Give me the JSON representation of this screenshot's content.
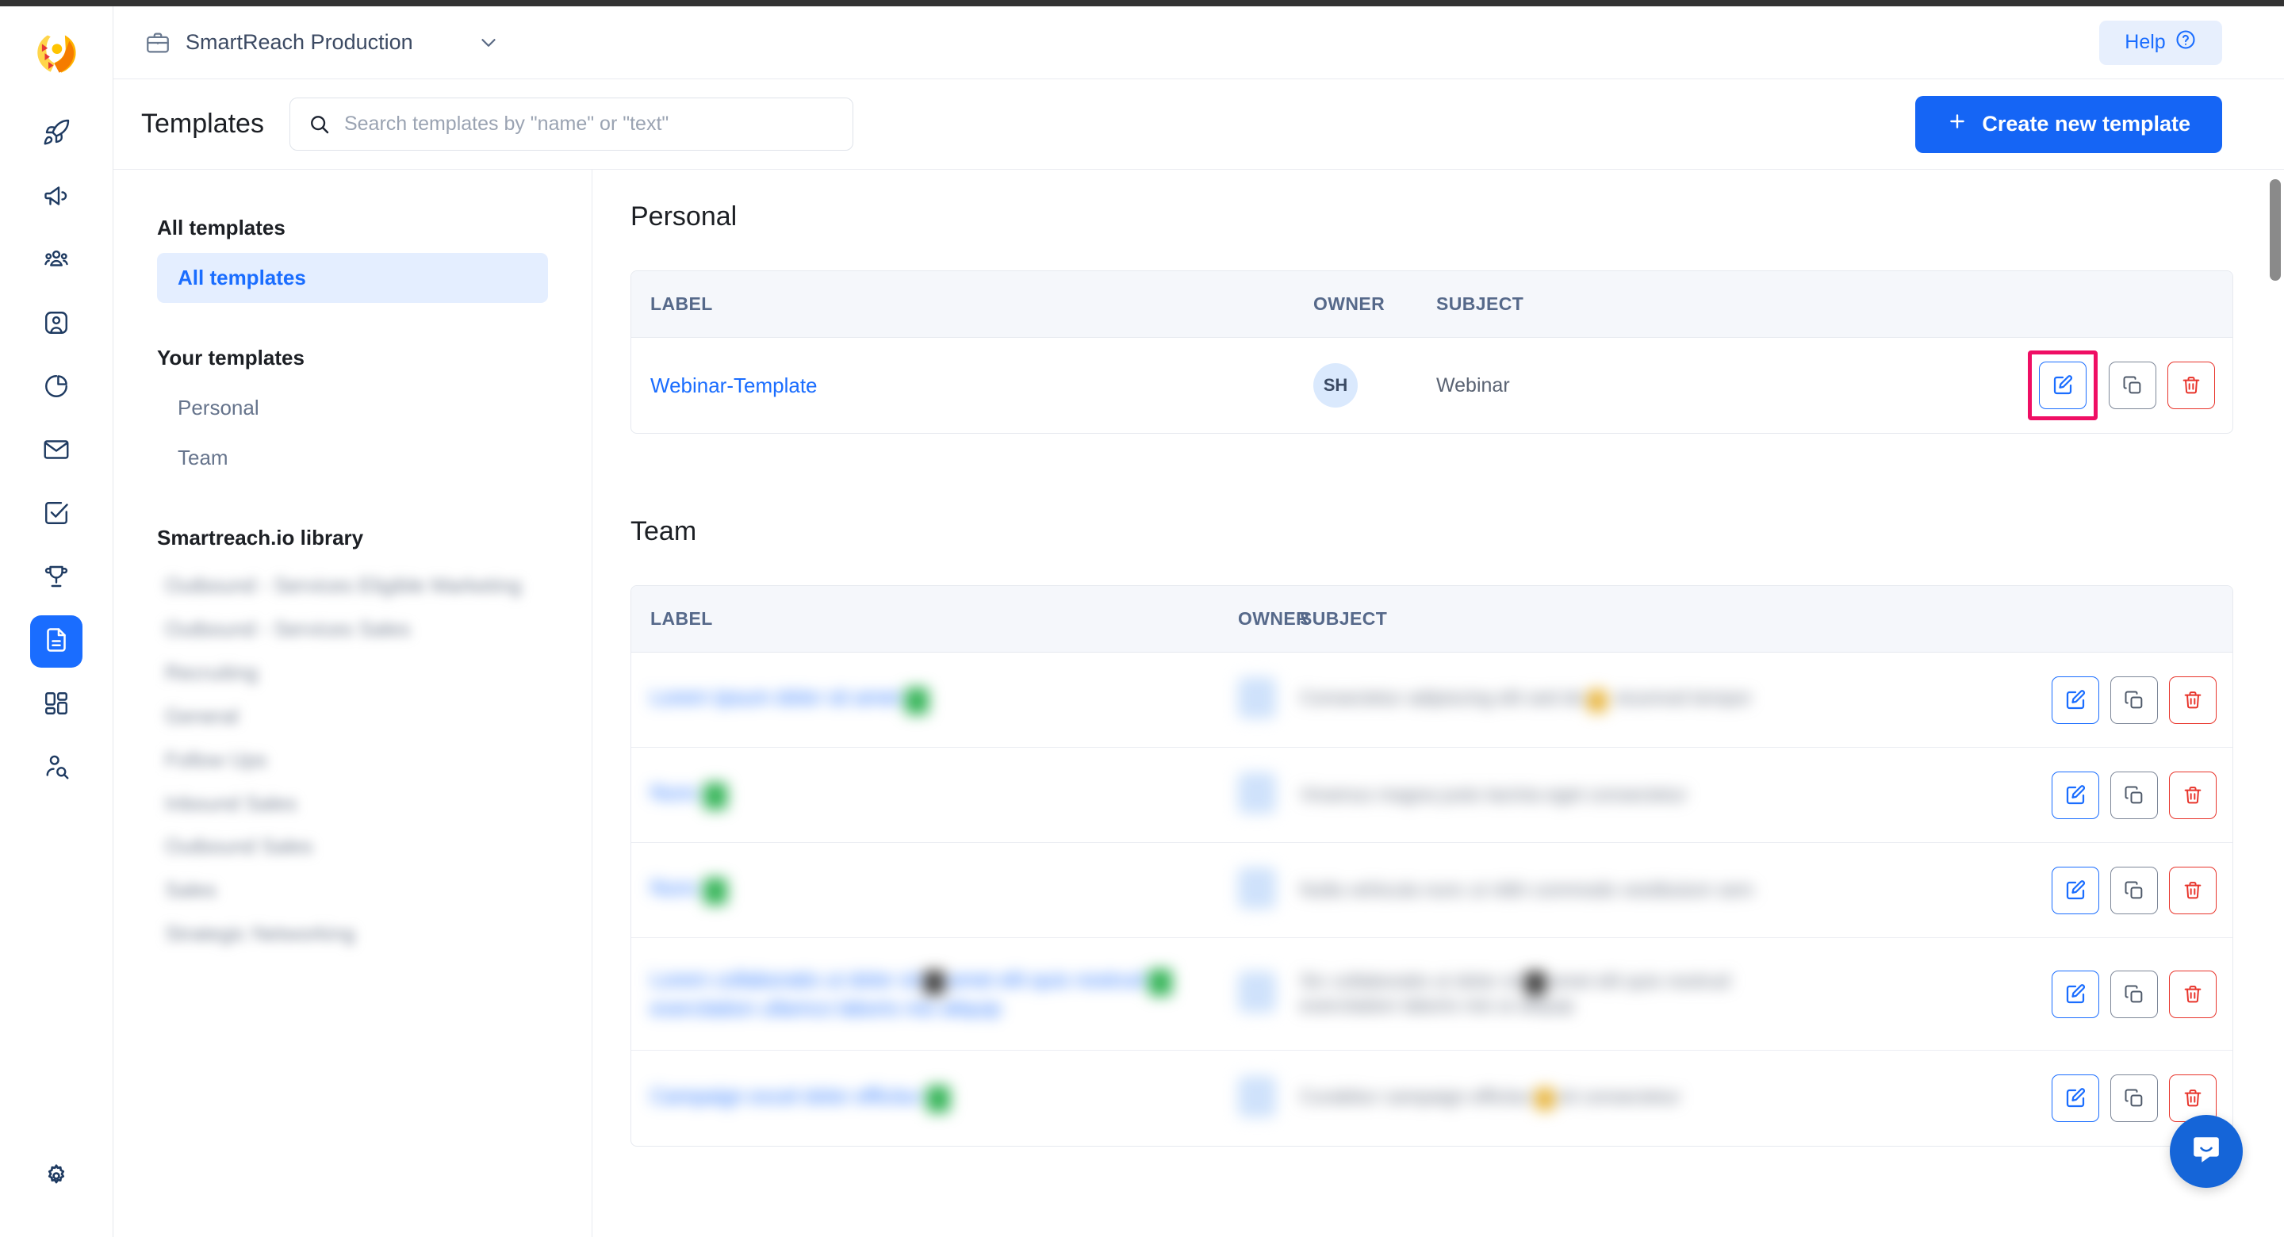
{
  "colors": {
    "accent": "#1a6dff",
    "primary_button": "#1565f5",
    "highlight_outline": "#ef0e64",
    "danger": "#e8342b",
    "rail_icon": "#1e3a61",
    "header_text": "#56698a"
  },
  "topbar": {
    "workspace_name": "SmartReach Production",
    "workspace_icon": "briefcase-icon",
    "caret_icon": "chevron-down-icon",
    "help_label": "Help",
    "help_icon": "question-circle-icon"
  },
  "pageheader": {
    "title": "Templates",
    "search_placeholder": "Search templates by \"name\" or \"text\"",
    "search_value": "",
    "search_icon": "search-icon",
    "create_label": "Create new template",
    "create_icon": "plus-icon"
  },
  "rail": {
    "logo": "smartreach-logo",
    "items": [
      {
        "icon": "rocket-icon",
        "name": "sidebar-item-campaigns",
        "active": false
      },
      {
        "icon": "megaphone-icon",
        "name": "sidebar-item-outreach",
        "active": false
      },
      {
        "icon": "users-group-icon",
        "name": "sidebar-item-prospects",
        "active": false
      },
      {
        "icon": "user-card-icon",
        "name": "sidebar-item-accounts",
        "active": false
      },
      {
        "icon": "pie-chart-icon",
        "name": "sidebar-item-reports",
        "active": false
      },
      {
        "icon": "envelope-icon",
        "name": "sidebar-item-inbox",
        "active": false
      },
      {
        "icon": "checkbox-check-icon",
        "name": "sidebar-item-tasks",
        "active": false
      },
      {
        "icon": "trophy-icon",
        "name": "sidebar-item-goals",
        "active": false
      },
      {
        "icon": "document-icon",
        "name": "sidebar-item-templates",
        "active": true
      },
      {
        "icon": "grid-apps-icon",
        "name": "sidebar-item-apps",
        "active": false
      },
      {
        "icon": "user-search-icon",
        "name": "sidebar-item-find-leads",
        "active": false
      }
    ],
    "settings": {
      "icon": "gear-icon",
      "name": "sidebar-item-settings"
    }
  },
  "subnav": {
    "groups": [
      {
        "heading": "All templates",
        "items": [
          {
            "label": "All templates",
            "active": true
          }
        ]
      },
      {
        "heading": "Your templates",
        "items": [
          {
            "label": "Personal",
            "active": false
          },
          {
            "label": "Team",
            "active": false
          }
        ]
      }
    ],
    "library_heading": "Smartreach.io library",
    "library_items": [
      "Outbound - Services Eligible Marketing",
      "Outbound - Services Sales",
      "Recruiting",
      "General",
      "Follow Ups",
      "Inbound Sales",
      "Outbound Sales",
      "Sales",
      "Strategic Networking"
    ]
  },
  "main": {
    "personal": {
      "title": "Personal",
      "columns": [
        "LABEL",
        "OWNER",
        "SUBJECT"
      ],
      "rows": [
        {
          "label": "Webinar-Template",
          "owner": "SH",
          "subject": "Webinar",
          "highlighted_action": "edit"
        }
      ]
    },
    "team": {
      "title": "Team",
      "columns": [
        "LABEL",
        "OWNER",
        "SUBJECT"
      ],
      "rows": [
        {
          "label": "redacted",
          "owner": "redacted",
          "subject": "redacted"
        },
        {
          "label": "redacted",
          "owner": "redacted",
          "subject": "redacted"
        },
        {
          "label": "redacted",
          "owner": "redacted",
          "subject": "redacted"
        },
        {
          "label": "redacted",
          "owner": "redacted",
          "subject": "redacted"
        },
        {
          "label": "redacted",
          "owner": "redacted",
          "subject": "redacted"
        }
      ]
    },
    "row_actions": {
      "edit": {
        "icon": "edit-pencil-icon",
        "name": "edit-template-button"
      },
      "copy": {
        "icon": "copy-duplicate-icon",
        "name": "duplicate-template-button"
      },
      "delete": {
        "icon": "trash-icon",
        "name": "delete-template-button"
      }
    }
  },
  "chat": {
    "icon": "chat-bubble-icon"
  },
  "scrollbar": {
    "name": "main-scrollbar"
  }
}
